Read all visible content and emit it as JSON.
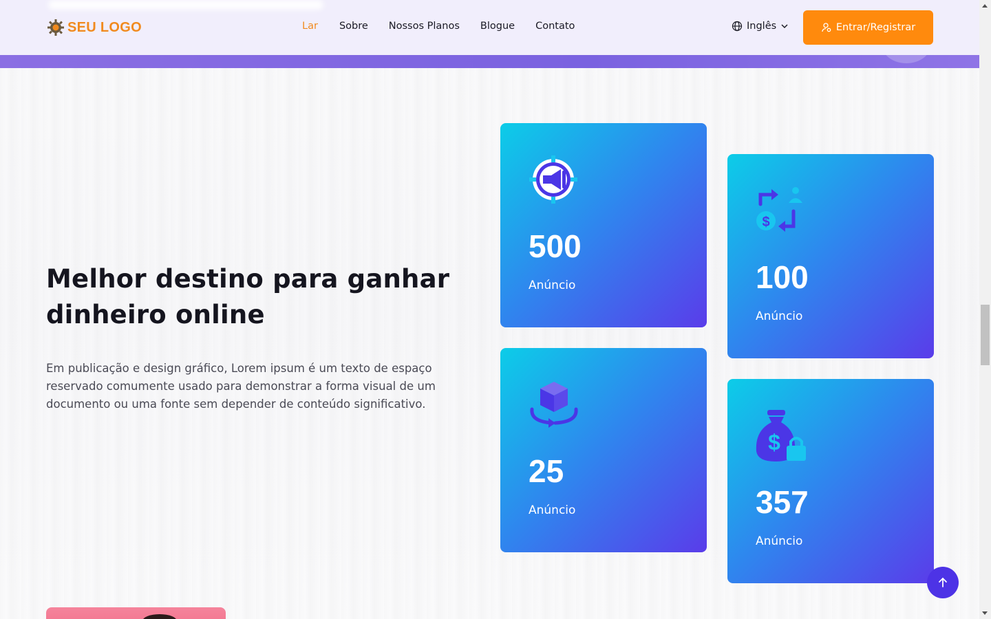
{
  "header": {
    "logo_text": "SEU LOGO",
    "nav": [
      {
        "label": "Lar",
        "active": true
      },
      {
        "label": "Sobre",
        "active": false
      },
      {
        "label": "Nossos Planos",
        "active": false
      },
      {
        "label": "Blogue",
        "active": false
      },
      {
        "label": "Contato",
        "active": false
      }
    ],
    "language": "Inglês",
    "login_label": "Entrar/Registrar"
  },
  "main": {
    "headline": "Melhor destino para ganhar dinheiro online",
    "description": "Em publicação e design gráfico, Lorem ipsum é um texto de espaço reservado comumente usado para demonstrar a forma visual de um documento ou uma fonte sem depender de conteúdo significativo."
  },
  "stats": [
    {
      "value": "500",
      "label": "Anúncio",
      "icon": "megaphone-target-icon"
    },
    {
      "value": "100",
      "label": "Anúncio",
      "icon": "money-exchange-icon"
    },
    {
      "value": "25",
      "label": "Anúncio",
      "icon": "rotating-box-icon"
    },
    {
      "value": "357",
      "label": "Anúncio",
      "icon": "money-bag-lock-icon"
    }
  ],
  "colors": {
    "accent": "#ff8a0d",
    "card_gradient_start": "#0ccde8",
    "card_gradient_end": "#5a3cea",
    "scroll_top": "#4d33e6"
  }
}
